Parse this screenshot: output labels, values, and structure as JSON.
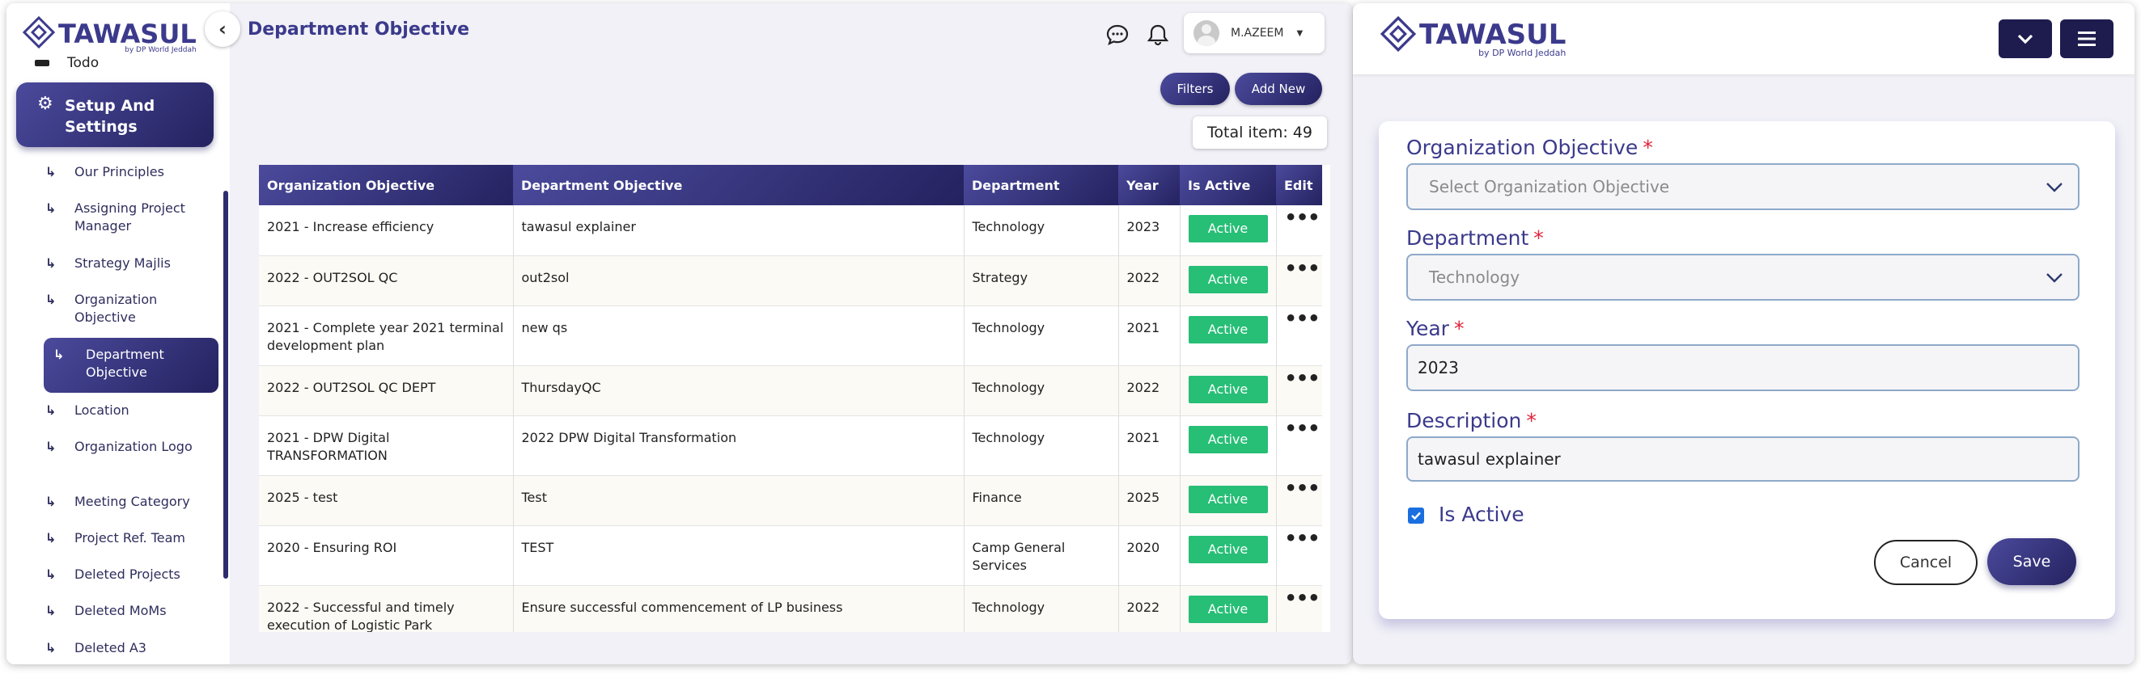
{
  "brand": {
    "name": "TAWASUL",
    "sub": "by DP World Jeddah"
  },
  "sidebar": {
    "todo": "Todo",
    "section": "Setup And Settings",
    "items": [
      {
        "label": "Our Principles"
      },
      {
        "label": "Assigning Project Manager"
      },
      {
        "label": "Strategy Majlis"
      },
      {
        "label": "Organization Objective"
      },
      {
        "label": "Department Objective",
        "active": true
      },
      {
        "label": "Location"
      },
      {
        "label": "Organization Logo"
      },
      {
        "label": "Meeting Category"
      },
      {
        "label": "Project Ref. Team"
      },
      {
        "label": "Deleted Projects"
      },
      {
        "label": "Deleted MoMs"
      },
      {
        "label": "Deleted A3"
      }
    ]
  },
  "header": {
    "title": "Department Objective",
    "user": "M.AZEEM",
    "icons": [
      "chat-icon",
      "bell-icon"
    ]
  },
  "toolbar": {
    "filters": "Filters",
    "add_new": "Add New",
    "total": "Total item: 49"
  },
  "table": {
    "columns": [
      "Organization Objective",
      "Department Objective",
      "Department",
      "Year",
      "Is Active",
      "Edit"
    ],
    "edit_glyph": "•••",
    "rows": [
      {
        "org": "2021 - Increase efficiency",
        "dept_obj": "tawasul explainer",
        "dept": "Technology",
        "year": "2023",
        "status": "Active"
      },
      {
        "org": "2022 - OUT2SOL QC",
        "dept_obj": "out2sol",
        "dept": "Strategy",
        "year": "2022",
        "status": "Active"
      },
      {
        "org": "2021 - Complete year 2021 terminal development plan",
        "dept_obj": "new qs",
        "dept": "Technology",
        "year": "2021",
        "status": "Active"
      },
      {
        "org": "2022 - OUT2SOL QC DEPT",
        "dept_obj": "ThursdayQC",
        "dept": "Technology",
        "year": "2022",
        "status": "Active"
      },
      {
        "org": "2021 - DPW Digital TRANSFORMATION",
        "dept_obj": "2022 DPW Digital Transformation",
        "dept": "Technology",
        "year": "2021",
        "status": "Active"
      },
      {
        "org": "2025 - test",
        "dept_obj": "Test",
        "dept": "Finance",
        "year": "2025",
        "status": "Active"
      },
      {
        "org": "2020 - Ensuring ROI",
        "dept_obj": "TEST",
        "dept": "Camp General Services",
        "year": "2020",
        "status": "Active"
      },
      {
        "org": "2022 - Successful and timely execution of Logistic Park",
        "dept_obj": "Ensure successful commencement of LP business",
        "dept": "Technology",
        "year": "2022",
        "status": "Active"
      }
    ]
  },
  "form": {
    "org_obj": {
      "label": "Organization Objective",
      "required": "*",
      "placeholder": "Select Organization Objective"
    },
    "department": {
      "label": "Department",
      "required": "*",
      "value": "Technology"
    },
    "year": {
      "label": "Year",
      "required": "*",
      "value": "2023"
    },
    "description": {
      "label": "Description",
      "required": "*",
      "value": "tawasul explainer"
    },
    "is_active": {
      "label": "Is Active",
      "checked": true
    },
    "cancel": "Cancel",
    "save": "Save"
  },
  "colors": {
    "primary": "#3b3a8c",
    "dark": "#24225f",
    "active_badge": "#27be76",
    "required": "#e1233b"
  }
}
